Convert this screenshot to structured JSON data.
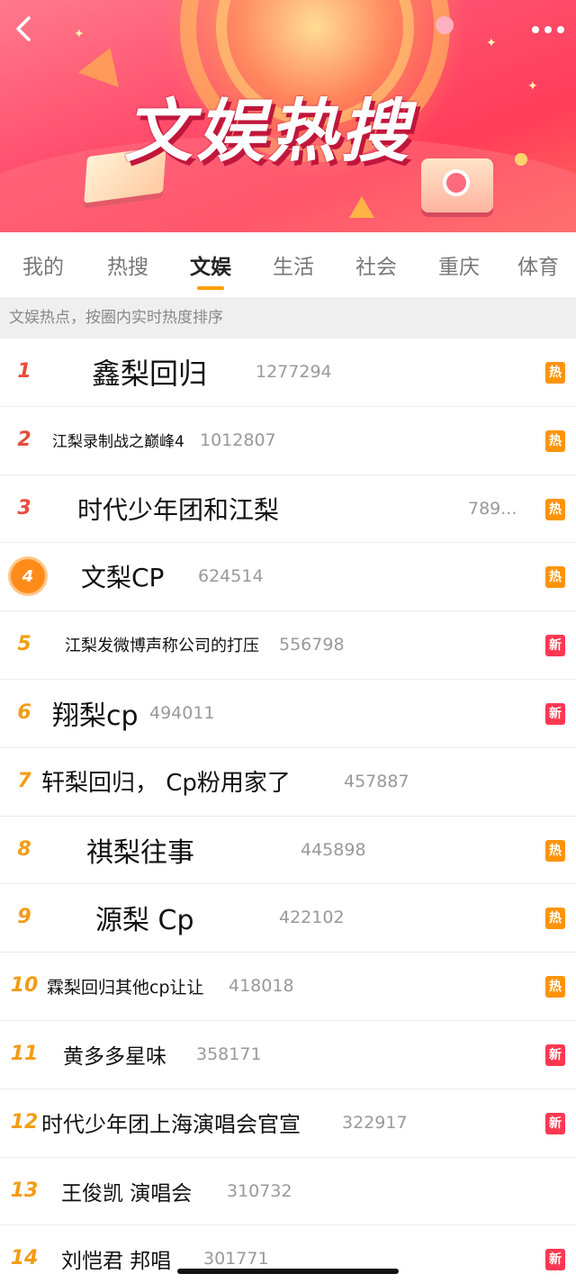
{
  "header": {
    "title": "文娱热搜",
    "back_icon": "chevron-left-icon",
    "more_icon": "more-dots-icon"
  },
  "tabs": [
    {
      "label": "我的",
      "active": false
    },
    {
      "label": "热搜",
      "active": false
    },
    {
      "label": "文娱",
      "active": true
    },
    {
      "label": "生活",
      "active": false
    },
    {
      "label": "社会",
      "active": false
    },
    {
      "label": "重庆",
      "active": false
    },
    {
      "label": "体育",
      "active": false
    }
  ],
  "notice": "文娱热点，按圈内实时热度排序",
  "colors": {
    "hot_tag": "#ff9406",
    "new_tag": "#ff3852",
    "tab_underline": "#ff9d00",
    "rank_top": "#e74c3c",
    "rank_other": "#f39c12"
  },
  "items": [
    {
      "rank": "1",
      "title": "鑫梨回归",
      "count": "1277294",
      "tag": "热"
    },
    {
      "rank": "2",
      "title": "江梨录制战之巅峰4",
      "count": "1012807",
      "tag": "热"
    },
    {
      "rank": "3",
      "title": "时代少年团和江梨",
      "count": "789...",
      "tag": "热"
    },
    {
      "rank": "4",
      "title": "文梨CP",
      "count": "624514",
      "tag": "热"
    },
    {
      "rank": "5",
      "title": "江梨发微博声称公司的打压",
      "count": "556798",
      "tag": "新"
    },
    {
      "rank": "6",
      "title": "翔梨cp",
      "count": "494011",
      "tag": "新"
    },
    {
      "rank": "7",
      "title": "轩梨回归， Cp粉用家了",
      "count": "457887",
      "tag": ""
    },
    {
      "rank": "8",
      "title": "祺梨往事",
      "count": "445898",
      "tag": "热"
    },
    {
      "rank": "9",
      "title": "源梨 Cp",
      "count": "422102",
      "tag": "热"
    },
    {
      "rank": "10",
      "title": "霖梨回归其他cp让让",
      "count": "418018",
      "tag": "热"
    },
    {
      "rank": "11",
      "title": "黄多多星味",
      "count": "358171",
      "tag": "新"
    },
    {
      "rank": "12",
      "title": "时代少年团上海演唱会官宣",
      "count": "322917",
      "tag": "新"
    },
    {
      "rank": "13",
      "title": "王俊凯 演唱会",
      "count": "310732",
      "tag": ""
    },
    {
      "rank": "14",
      "title": "刘恺君 邦唱",
      "count": "301771",
      "tag": "新"
    }
  ]
}
